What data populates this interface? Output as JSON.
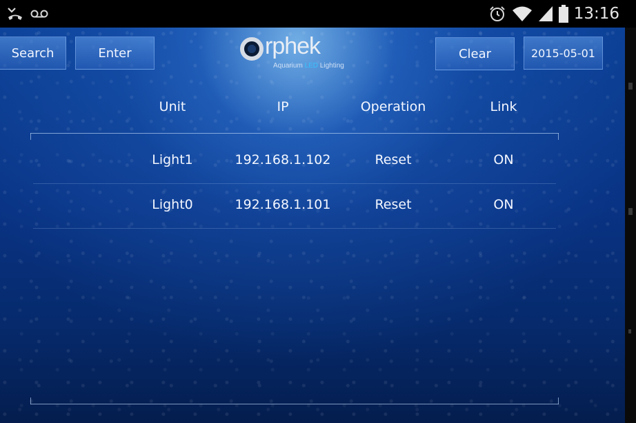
{
  "status_bar": {
    "time": "13:16",
    "left_icons": [
      "missed-call-icon",
      "voicemail-icon"
    ],
    "right_icons": [
      "alarm-icon",
      "wifi-icon",
      "signal-icon",
      "battery-icon"
    ]
  },
  "toolbar": {
    "search_label": "Search",
    "enter_label": "Enter",
    "clear_label": "Clear",
    "date_label": "2015-05-01"
  },
  "logo": {
    "name": "rphek",
    "tagline_a": "Aquarium ",
    "tagline_led": "LED",
    "tagline_b": " Lighting"
  },
  "table": {
    "headers": [
      "Unit",
      "IP",
      "Operation",
      "Link"
    ],
    "rows": [
      {
        "unit": "Light1",
        "ip": "192.168.1.102",
        "operation": "Reset",
        "link": "ON"
      },
      {
        "unit": "Light0",
        "ip": "192.168.1.101",
        "operation": "Reset",
        "link": "ON"
      }
    ]
  },
  "colors": {
    "background": "#0a3a8d",
    "button": "#4a86d8",
    "text": "#f4f7ff",
    "led_accent": "#37c2ff"
  }
}
